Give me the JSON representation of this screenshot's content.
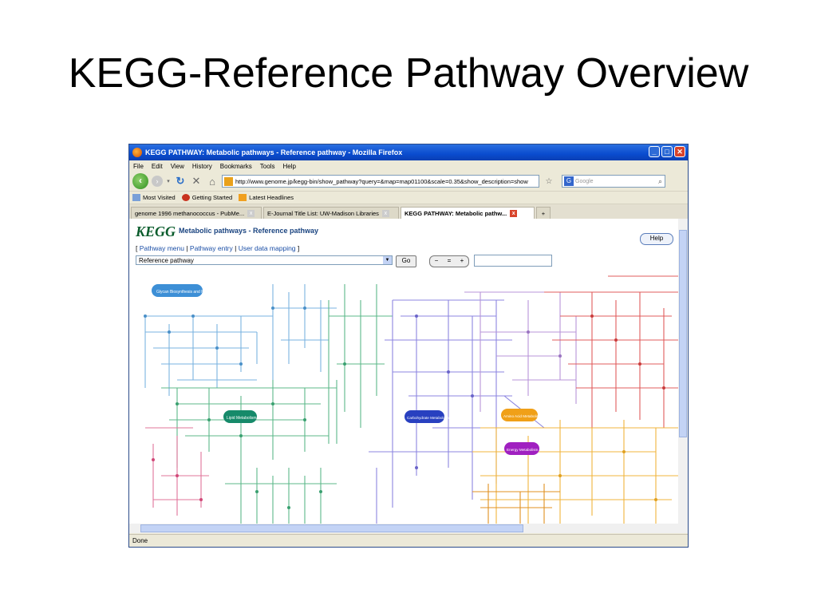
{
  "slide": {
    "title": "KEGG-Reference Pathway Overview"
  },
  "window": {
    "title": "KEGG PATHWAY: Metabolic pathways - Reference pathway - Mozilla Firefox",
    "controls": [
      "minimize",
      "maximize",
      "close"
    ]
  },
  "menu": [
    "File",
    "Edit",
    "View",
    "History",
    "Bookmarks",
    "Tools",
    "Help"
  ],
  "nav": {
    "url": "http://www.genome.jp/kegg-bin/show_pathway?query=&map=map01100&scale=0.35&show_description=show",
    "search_placeholder": "Google"
  },
  "bookmarks": [
    "Most Visited",
    "Getting Started",
    "Latest Headlines"
  ],
  "tabs": [
    {
      "label": "genome 1996 methanococcus - PubMe...",
      "active": false
    },
    {
      "label": "E-Journal Title List: UW-Madison Libraries",
      "active": false
    },
    {
      "label": "KEGG PATHWAY: Metabolic pathw...",
      "active": true
    }
  ],
  "page": {
    "logo": "KEGG",
    "title": "Metabolic pathways - Reference pathway",
    "help_label": "Help",
    "links": [
      "Pathway menu",
      "Pathway entry",
      "User data mapping"
    ],
    "select_value": "Reference pathway",
    "go_label": "Go",
    "zoom_labels": [
      "−",
      "=",
      "+"
    ]
  },
  "map_labels": {
    "glycan": "Glycan Biosynthesis and Metabolism",
    "lipid": "Lipid Metabolism",
    "carbohydrate": "Carbohydrate Metabolism",
    "amino": "Amino Acid Metabolism",
    "energy": "Energy Metabolism"
  },
  "status": "Done"
}
